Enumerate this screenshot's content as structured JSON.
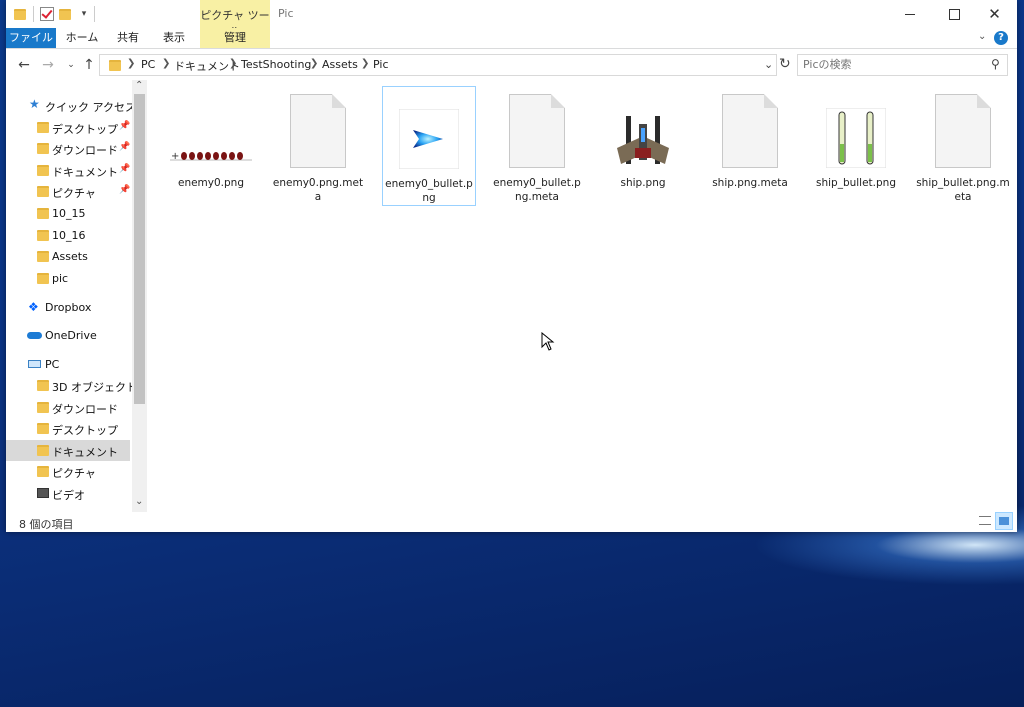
{
  "window": {
    "title": "Pic",
    "context_tab": "ピクチャ ツール",
    "tabs": [
      {
        "label": "ファイル"
      },
      {
        "label": "ホーム"
      },
      {
        "label": "共有"
      },
      {
        "label": "表示"
      },
      {
        "label": "管理"
      }
    ],
    "help_icon": "?"
  },
  "address": {
    "breadcrumbs": [
      "PC",
      "ドキュメント",
      "TestShooting",
      "Assets",
      "Pic"
    ],
    "search_placeholder": "Picの検索"
  },
  "nav": {
    "quick_access": "クイック アクセス",
    "quick_items": [
      {
        "label": "デスクトップ",
        "icon": "desktop-folder-icon",
        "pinned": true
      },
      {
        "label": "ダウンロード",
        "icon": "download-folder-icon",
        "pinned": true
      },
      {
        "label": "ドキュメント",
        "icon": "documents-folder-icon",
        "pinned": true
      },
      {
        "label": "ピクチャ",
        "icon": "pictures-folder-icon",
        "pinned": true
      },
      {
        "label": "10_15",
        "icon": "folder-icon"
      },
      {
        "label": "10_16",
        "icon": "folder-icon"
      },
      {
        "label": "Assets",
        "icon": "folder-icon"
      },
      {
        "label": "pic",
        "icon": "folder-icon"
      }
    ],
    "dropbox": "Dropbox",
    "onedrive": "OneDrive",
    "pc": "PC",
    "pc_items": [
      {
        "label": "3D オブジェクト",
        "icon": "3d-objects-folder-icon"
      },
      {
        "label": "ダウンロード",
        "icon": "download-folder-icon"
      },
      {
        "label": "デスクトップ",
        "icon": "desktop-folder-icon"
      },
      {
        "label": "ドキュメント",
        "icon": "documents-folder-icon"
      },
      {
        "label": "ピクチャ",
        "icon": "pictures-folder-icon"
      },
      {
        "label": "ビデオ",
        "icon": "videos-folder-icon"
      }
    ]
  },
  "files": [
    {
      "name": "enemy0.png",
      "kind": "enemy-sprite"
    },
    {
      "name": "enemy0.png.meta",
      "kind": "document"
    },
    {
      "name": "enemy0_bullet.png",
      "kind": "bullet-sprite",
      "selected": true
    },
    {
      "name": "enemy0_bullet.png.meta",
      "kind": "document"
    },
    {
      "name": "ship.png",
      "kind": "ship-sprite"
    },
    {
      "name": "ship.png.meta",
      "kind": "document"
    },
    {
      "name": "ship_bullet.png",
      "kind": "ship-bullet-sprite"
    },
    {
      "name": "ship_bullet.png.meta",
      "kind": "document"
    }
  ],
  "status": {
    "item_count": "8 個の項目"
  },
  "colors": {
    "file_tab": "#1979ca",
    "context_tab": "#f8f0a4",
    "selection_border": "#99d1ff"
  }
}
